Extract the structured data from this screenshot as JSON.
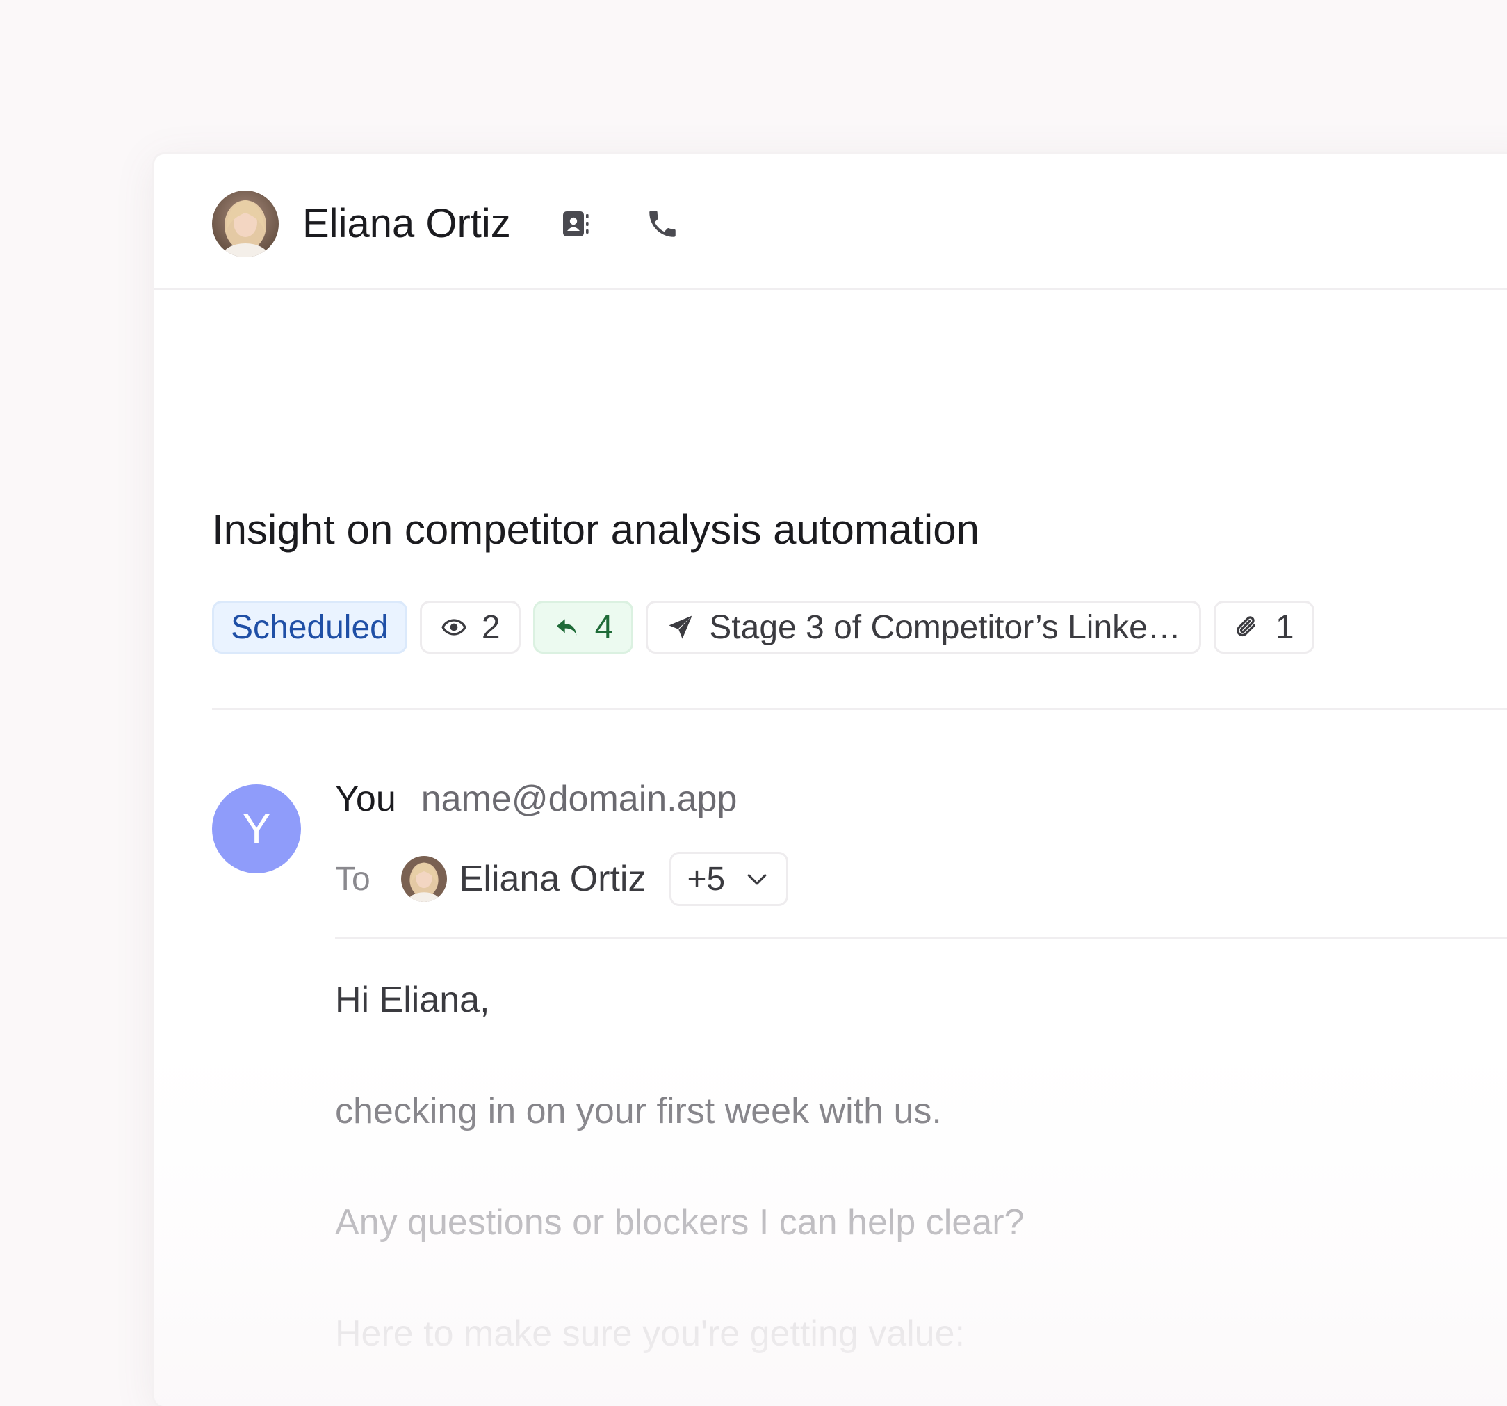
{
  "header": {
    "contact_name": "Eliana Ortiz",
    "avatar_icon": "person-photo-avatar",
    "contact_card_icon": "contact-book-icon",
    "phone_icon": "phone-icon"
  },
  "email": {
    "subject": "Insight on competitor analysis automation",
    "chips": {
      "status": "Scheduled",
      "views": "2",
      "replies": "4",
      "sequence": "Stage 3 of Competitor’s Linke…",
      "attachments": "1"
    },
    "sender": {
      "avatar_initial": "Y",
      "name": "You",
      "email": "name@domain.app"
    },
    "recipients": {
      "to_label": "To",
      "primary_name": "Eliana Ortiz",
      "more_count": "+5"
    },
    "body_lines": [
      "Hi Eliana,",
      "checking in on your first week with us.",
      "Any questions or blockers I can help clear?",
      "Here to make sure you're getting value:"
    ]
  },
  "colors": {
    "scheduled_bg": "#eaf3ff",
    "scheduled_text": "#1f4fa6",
    "replies_bg": "#ecfaf0",
    "replies_text": "#1f6b38",
    "sender_avatar": "#8f9cfa"
  }
}
